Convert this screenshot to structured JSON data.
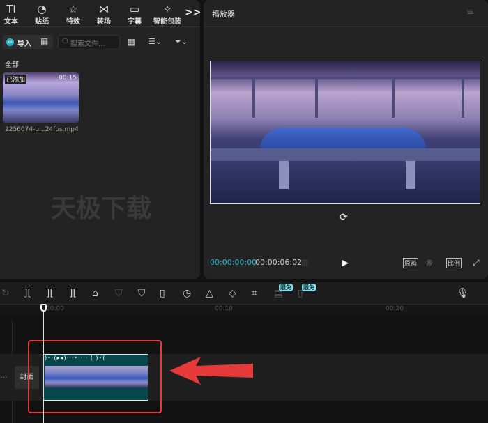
{
  "media_tabs": [
    {
      "icon": "text-icon",
      "glyph": "TI",
      "label": "文本"
    },
    {
      "icon": "sticker-icon",
      "glyph": "◔",
      "label": "贴纸"
    },
    {
      "icon": "effects-icon",
      "glyph": "☆",
      "label": "特效"
    },
    {
      "icon": "transition-icon",
      "glyph": "⋈",
      "label": "转场"
    },
    {
      "icon": "subtitle-icon",
      "glyph": "▭",
      "label": "字幕"
    },
    {
      "icon": "smart-pack-icon",
      "glyph": "✧",
      "label": "智能包装"
    }
  ],
  "more_tabs": ">>",
  "import_label": "导入",
  "search_placeholder": "搜索文件...",
  "filter_all": "全部",
  "media_item": {
    "badge": "已添加",
    "duration": "00:15",
    "filename": "2256074-u...24fps.mp4"
  },
  "watermark": "天极下载",
  "player": {
    "title": "播放器",
    "current_time": "00:00:00:00",
    "total_time": "00:00:06:02",
    "original_label": "原画",
    "ratio_label": "比例"
  },
  "toolbar": {
    "limited_free": "限免"
  },
  "ruler": [
    "00:00",
    "00:10",
    "00:20"
  ],
  "track": {
    "cover_label": "封面"
  },
  "colors": {
    "accent": "#20b8c8",
    "highlight": "#e63a3a",
    "clip": "#05474a"
  }
}
